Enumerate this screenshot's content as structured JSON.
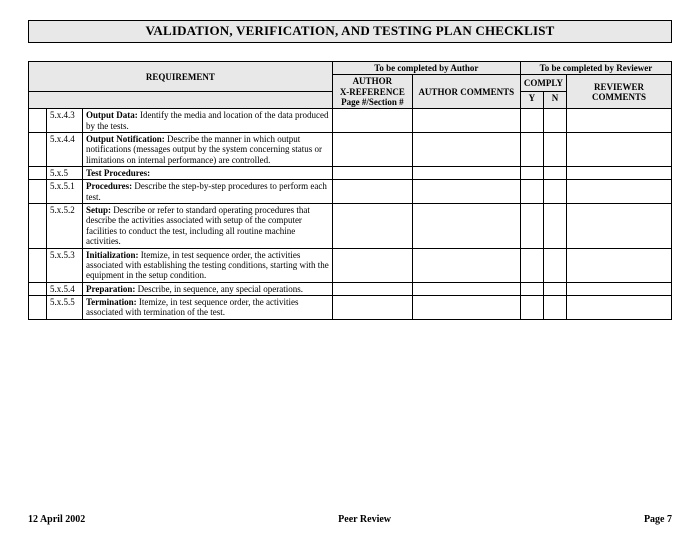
{
  "title": "VALIDATION, VERIFICATION, AND TESTING PLAN CHECKLIST",
  "headers": {
    "author_section": "To be completed by Author",
    "reviewer_section": "To be completed by Reviewer",
    "requirement": "REQUIREMENT",
    "xref_line1": "AUTHOR",
    "xref_line2": "X-REFERENCE",
    "xref_line3": "Page #/Section #",
    "author_comments": "AUTHOR COMMENTS",
    "comply": "COMPLY",
    "reviewer_comments_line1": "REVIEWER",
    "reviewer_comments_line2": "COMMENTS",
    "y": "Y",
    "n": "N"
  },
  "rows": [
    {
      "num": "5.x.4.3",
      "bold": "Output Data:",
      "rest": "  Identify the media and location of the data produced by the tests."
    },
    {
      "num": "5.x.4.4",
      "bold": "Output Notification:",
      "rest": "  Describe the manner in which output notifications (messages output by the system concerning status or limitations on internal performance) are controlled."
    },
    {
      "num": "5.x.5",
      "bold": "Test Procedures:",
      "rest": ""
    },
    {
      "num": "5.x.5.1",
      "bold": "Procedures:",
      "rest": "  Describe the step-by-step procedures to perform each test."
    },
    {
      "num": "5.x.5.2",
      "bold": "Setup:",
      "rest": "  Describe or refer to standard operating procedures that describe the activities associated with setup of the computer facilities to conduct the test, including all routine machine activities."
    },
    {
      "num": "5.x.5.3",
      "bold": "Initialization:",
      "rest": "  Itemize, in test sequence order, the activities associated with establishing the testing conditions, starting with the equipment in the setup condition."
    },
    {
      "num": "5.x.5.4",
      "bold": "Preparation:",
      "rest": "  Describe, in sequence, any special operations."
    },
    {
      "num": "5.x.5.5",
      "bold": "Termination:",
      "rest": "  Itemize, in test sequence order, the activities associated with termination of the test."
    }
  ],
  "footer": {
    "date": "12 April 2002",
    "center": "Peer Review",
    "page": "Page 7"
  }
}
